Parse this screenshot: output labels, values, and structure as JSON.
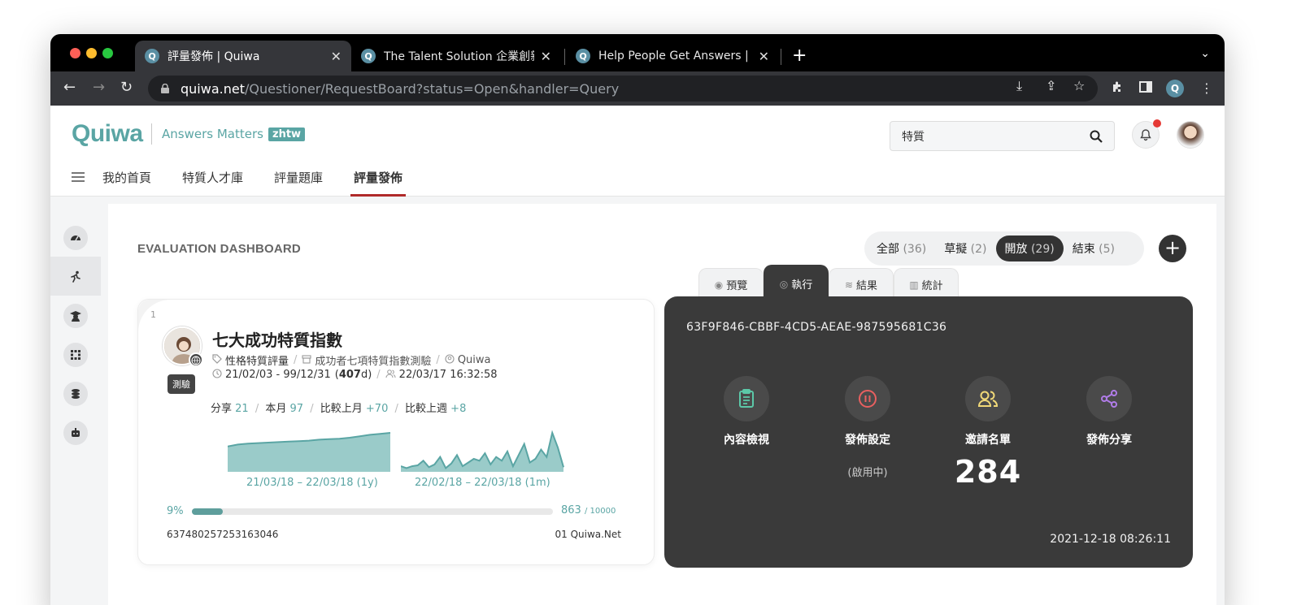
{
  "browser": {
    "tabs": [
      {
        "title": "評量發佈 | Quiwa",
        "active": true
      },
      {
        "title": "The Talent Solution 企業創新人才",
        "active": false
      },
      {
        "title": "Help People Get Answers | Quiwa",
        "active": false
      }
    ],
    "url_domain": "quiwa.net",
    "url_path": "/Questioner/RequestBoard?status=Open&handler=Query",
    "favicon_letter": "Q",
    "profile_letter": "Q"
  },
  "header": {
    "logo": "Quiwa",
    "tagline": "Answers Matters",
    "lang_badge": "zhtw",
    "search_value": "特質",
    "nav": [
      {
        "label": "我的首頁",
        "active": false
      },
      {
        "label": "特質人才庫",
        "active": false
      },
      {
        "label": "評量題庫",
        "active": false
      },
      {
        "label": "評量發佈",
        "active": true
      }
    ]
  },
  "dashboard": {
    "title": "EVALUATION DASHBOARD",
    "filters": [
      {
        "label": "全部",
        "count": "(36)",
        "active": false
      },
      {
        "label": "草擬",
        "count": "(2)",
        "active": false
      },
      {
        "label": "開放",
        "count": "(29)",
        "active": true
      },
      {
        "label": "結束",
        "count": "(5)",
        "active": false
      }
    ],
    "add_label": "+"
  },
  "card": {
    "index": "1",
    "type_chip": "測驗",
    "title": "七大成功特質指數",
    "category": "性格特質評量",
    "subject": "成功者七項特質指數測驗",
    "owner": "Quiwa",
    "date_range": "21/02/03 - 99/12/31",
    "duration_open": "(",
    "duration_days": "407",
    "duration_close": "d)",
    "updated": "22/03/17 16:32:58",
    "stats": {
      "share_label": "分享",
      "share_value": "21",
      "month_label": "本月",
      "month_value": "97",
      "lastmonth_label": "比較上月",
      "lastmonth_value": "+70",
      "lastweek_label": "比較上週",
      "lastweek_value": "+8"
    },
    "spark_year_label": "21/03/18 – 22/03/18 (1y)",
    "spark_month_label": "22/02/18 – 22/03/18 (1m)",
    "spark_year_values": [
      52,
      56,
      58,
      59,
      60,
      61,
      62,
      63,
      64,
      66,
      67,
      68,
      70,
      73,
      76,
      78,
      80
    ],
    "spark_month_values": [
      6,
      4,
      6,
      7,
      12,
      5,
      8,
      16,
      4,
      9,
      18,
      6,
      10,
      14,
      12,
      20,
      8,
      16,
      12,
      22,
      6,
      18,
      30,
      10,
      14,
      24,
      16,
      42,
      26,
      5
    ],
    "progress_pct": "9%",
    "progress_fraction": 0.086,
    "progress_count": "863",
    "progress_total": "/ 10000",
    "footer_id": "637480257253163046",
    "footer_org": "01 Quiwa.Net"
  },
  "panel": {
    "tabs": [
      {
        "label": "預覽",
        "icon": "eye-icon",
        "active": false
      },
      {
        "label": "執行",
        "icon": "target-icon",
        "active": true
      },
      {
        "label": "結果",
        "icon": "database-icon",
        "active": false
      },
      {
        "label": "統計",
        "icon": "bar-chart-icon",
        "active": false
      }
    ],
    "guid": "63F9F846-CBBF-4CD5-AEAE-987595681C36",
    "actions": [
      {
        "label": "內容檢視",
        "icon": "clipboard-icon",
        "color": "#5cc8a8",
        "sub": "",
        "big": ""
      },
      {
        "label": "發佈設定",
        "icon": "pause-icon",
        "color": "#e86060",
        "sub": "(啟用中)",
        "big": ""
      },
      {
        "label": "邀請名單",
        "icon": "users-icon",
        "color": "#f0d878",
        "sub": "",
        "big": "284"
      },
      {
        "label": "發佈分享",
        "icon": "share-icon",
        "color": "#b07ce8",
        "sub": "",
        "big": ""
      }
    ],
    "timestamp": "2021-12-18 08:26:11"
  },
  "colors": {
    "accent": "#5aa5a4",
    "nav_underline": "#b02a2a",
    "panel_bg": "#3a3a3a"
  }
}
